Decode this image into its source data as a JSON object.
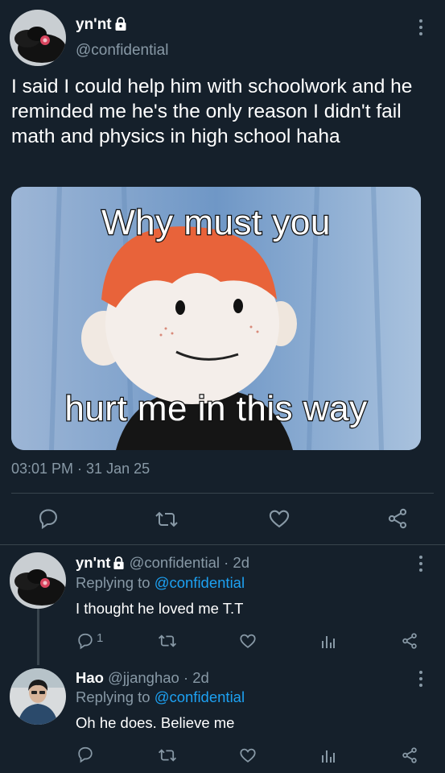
{
  "tweet": {
    "display_name": "yn'nt",
    "handle": "@confidential",
    "text": "I said I could help him with schoolwork and he reminded me he's the only reason I didn't fail math and physics in high school haha",
    "meme": {
      "top_caption": "Why must you",
      "bottom_caption": "hurt me in this way"
    },
    "timestamp": "03:01 PM · 31 Jan 25",
    "actions": [
      "reply-icon",
      "retweet-icon",
      "like-icon",
      "share-icon"
    ]
  },
  "replies": [
    {
      "display_name": "yn'nt",
      "handle": "@confidential",
      "age": "· 2d",
      "replying_prefix": "Replying to",
      "replying_to": "@confidential",
      "text": "I thought he loved me T.T",
      "reply_count": "1"
    },
    {
      "display_name": "Hao",
      "handle": "@jjanghao",
      "age": "· 2d",
      "replying_prefix": "Replying to",
      "replying_to": "@confidential",
      "text": "Oh he does. Believe me",
      "reply_count": ""
    }
  ],
  "colors": {
    "background": "#15202b",
    "muted": "#8899a6",
    "link": "#1da1f2",
    "divider": "#38444d"
  }
}
